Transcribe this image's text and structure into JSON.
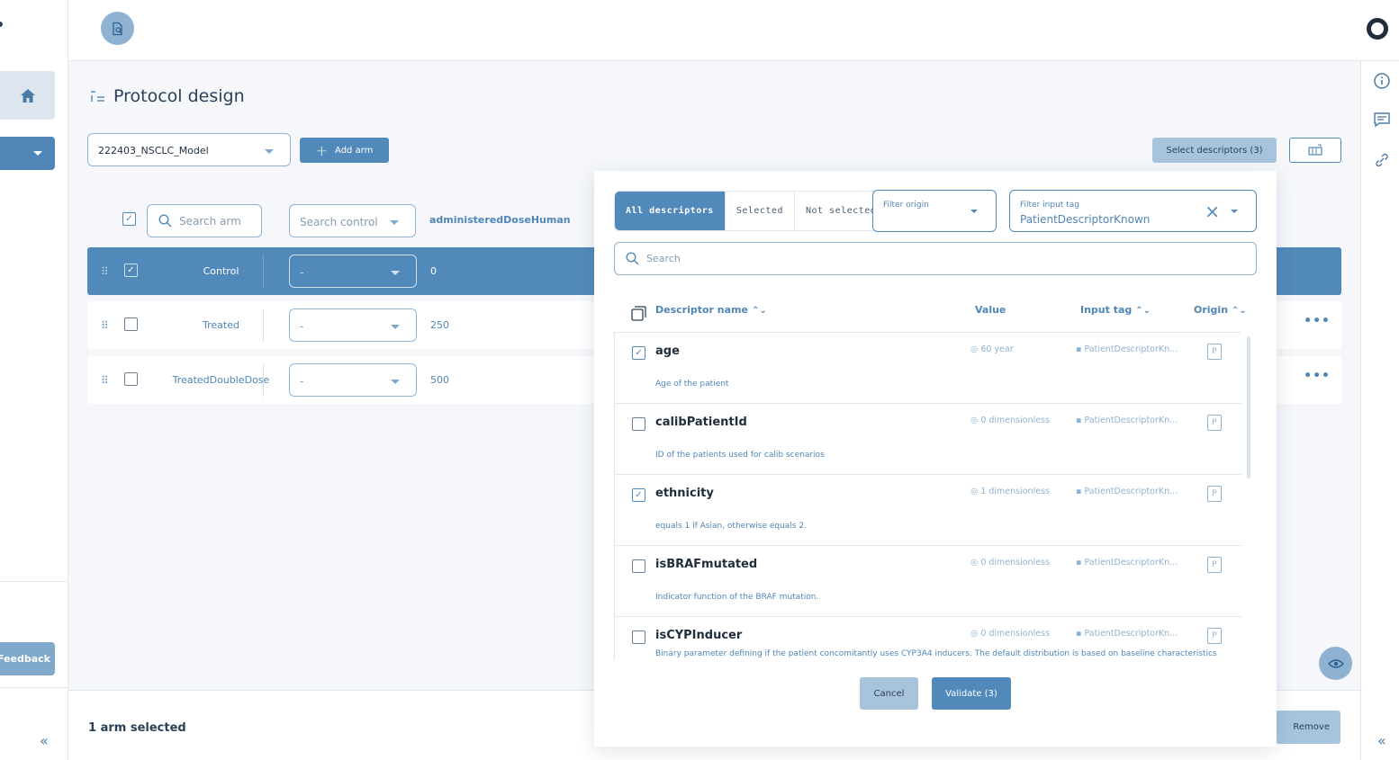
{
  "sidebar": {
    "feedback_label": "Feedback",
    "collapse_glyph": "«"
  },
  "rail": {
    "collapse_glyph": "«"
  },
  "page": {
    "title": "Protocol design",
    "model_select_value": "222403_NSCLC_Model",
    "add_arm_label": "Add arm",
    "select_descriptors_label": "Select descriptors (3)",
    "search_arm_placeholder": "Search arm",
    "search_control_placeholder": "Search control",
    "column_dose": "administeredDoseHuman"
  },
  "arms": [
    {
      "name": "Control",
      "control": "-",
      "dose": "0",
      "checked": true
    },
    {
      "name": "Treated",
      "control": "-",
      "dose": "250",
      "checked": false
    },
    {
      "name": "TreatedDoubleDose",
      "control": "-",
      "dose": "500",
      "checked": false
    }
  ],
  "row_menu_glyph": "•••",
  "footer": {
    "selected_count": "1 arm selected",
    "remove_label": "Remove"
  },
  "modal": {
    "tabs": [
      "All descriptors",
      "Selected",
      "Not selected"
    ],
    "filter_origin_label": "Filter origin",
    "filter_tag_label": "Filter input tag",
    "filter_tag_value": "PatientDescriptorKnown",
    "search_placeholder": "Search",
    "columns": {
      "name": "Descriptor name",
      "value": "Value",
      "tag": "Input tag",
      "origin": "Origin"
    },
    "descriptors": [
      {
        "name": "age",
        "desc": "Age of the patient",
        "value": "60 year",
        "tag": "PatientDescriptorKn...",
        "origin": "P",
        "checked": true
      },
      {
        "name": "calibPatientId",
        "desc": "ID of the patients used for calib scenarios",
        "value": "0 dimensionless",
        "tag": "PatientDescriptorKn...",
        "origin": "P",
        "checked": false
      },
      {
        "name": "ethnicity",
        "desc": "equals 1 if Asian, otherwise equals 2.",
        "value": "1 dimensionless",
        "tag": "PatientDescriptorKn...",
        "origin": "P",
        "checked": true
      },
      {
        "name": "isBRAFmutated",
        "desc": "Indicator function of the BRAF mutation.",
        "value": "0 dimensionless",
        "tag": "PatientDescriptorKn...",
        "origin": "P",
        "checked": false
      },
      {
        "name": "isCYPInducer",
        "desc": "Binary parameter defining if the patient concomitantly uses CYP3A4 inducers. The default distribution is based on baseline characteristics",
        "value": "0 dimensionless",
        "tag": "PatientDescriptorKn...",
        "origin": "P",
        "checked": false
      }
    ],
    "cancel_label": "Cancel",
    "validate_label": "Validate (3)"
  },
  "colors": {
    "primary": "#5189ba",
    "light": "#a8c4dd",
    "text": "#2b4158"
  }
}
